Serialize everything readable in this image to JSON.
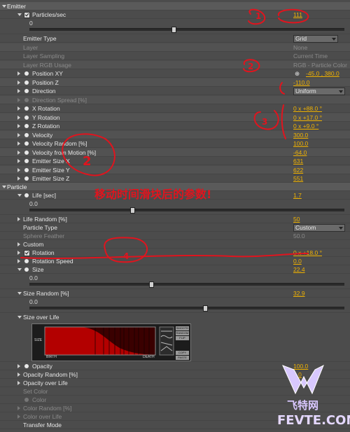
{
  "sections": {
    "emitter": "Emitter",
    "particle": "Particle"
  },
  "particles_sec": {
    "label": "Particles/sec",
    "value": "111",
    "slider_min": "0",
    "slider_fraction": 0.45
  },
  "emitter_rows": [
    {
      "label": "Emitter Type",
      "value": "Grid",
      "type": "dropdown"
    },
    {
      "label": "Layer",
      "value": "None",
      "type": "dim"
    },
    {
      "label": "Layer Sampling",
      "value": "Current Time",
      "type": "dim"
    },
    {
      "label": "Layer RGB Usage",
      "value": "RGB - Particle Color",
      "type": "dim"
    },
    {
      "label": "Position XY",
      "value": "-45.0 , 380.0",
      "type": "xy"
    },
    {
      "label": "Position Z",
      "value": "-110.0",
      "type": "num"
    },
    {
      "label": "Direction",
      "value": "Uniform",
      "type": "dropdown"
    },
    {
      "label": "Direction Spread [%]",
      "value": "",
      "type": "dimrow"
    },
    {
      "label": "X Rotation",
      "value": "0 x +88.0 °",
      "type": "num"
    },
    {
      "label": "Y Rotation",
      "value": "0 x +17.0 °",
      "type": "num"
    },
    {
      "label": "Z Rotation",
      "value": "0 x +9.0 °",
      "type": "num"
    },
    {
      "label": "Velocity",
      "value": "300.0",
      "type": "num"
    },
    {
      "label": "Velocity Random [%]",
      "value": "100.0",
      "type": "num"
    },
    {
      "label": "Velocity from Motion [%]",
      "value": "-64.0",
      "type": "num"
    },
    {
      "label": "Emitter Size X",
      "value": "631",
      "type": "num"
    },
    {
      "label": "Emitter Size Y",
      "value": "622",
      "type": "num"
    },
    {
      "label": "Emitter Size Z",
      "value": "551",
      "type": "num"
    }
  ],
  "life": {
    "label": "Life [sec]",
    "value": "1.7",
    "slider_min": "0.0",
    "slider_fraction": 0.32
  },
  "life_random": {
    "label": "Life Random [%]",
    "value": "50"
  },
  "particle_type": {
    "label": "Particle Type",
    "value": "Custom"
  },
  "sphere_feather": {
    "label": "Sphere Feather",
    "value": "50.0"
  },
  "custom": {
    "label": "Custom"
  },
  "rotation": {
    "label": "Rotation",
    "value": "0 x +18.0 °"
  },
  "rotation_speed": {
    "label": "Rotation Speed",
    "value": "0.0"
  },
  "size": {
    "label": "Size",
    "value": "22.4",
    "slider_min": "0.0",
    "slider_fraction": 0.38
  },
  "size_random": {
    "label": "Size Random [%]",
    "value": "32.9",
    "slider_min": "0.0",
    "slider_fraction": 0.55
  },
  "size_over_life": {
    "label": "Size over Life",
    "axis_y": "SIZE",
    "axis_x_left": "BIRTH",
    "axis_x_right": "DEATH",
    "buttons": [
      "SMOOTH",
      "RANDOM",
      "FLIP",
      "COPY",
      "PASTE"
    ]
  },
  "opacity": {
    "label": "Opacity",
    "value": "100.0"
  },
  "opacity_random": {
    "label": "Opacity Random [%]",
    "value": "0.0"
  },
  "opacity_over_life": {
    "label": "Opacity over Life"
  },
  "set_color": {
    "label": "Set Color",
    "value": "At Birth"
  },
  "color": {
    "label": "Color"
  },
  "color_random": {
    "label": "Color Random [%]"
  },
  "color_over_life": {
    "label": "Color over Life"
  },
  "transfer_mode": {
    "label": "Transfer Mode"
  },
  "annotation_text": "移动时间滑块后的参数!",
  "watermark": {
    "name_cn": "飞特网",
    "domain": "FEVTE.COM"
  },
  "colors": {
    "value": "#f2b300",
    "annotation": "#e0141e"
  }
}
